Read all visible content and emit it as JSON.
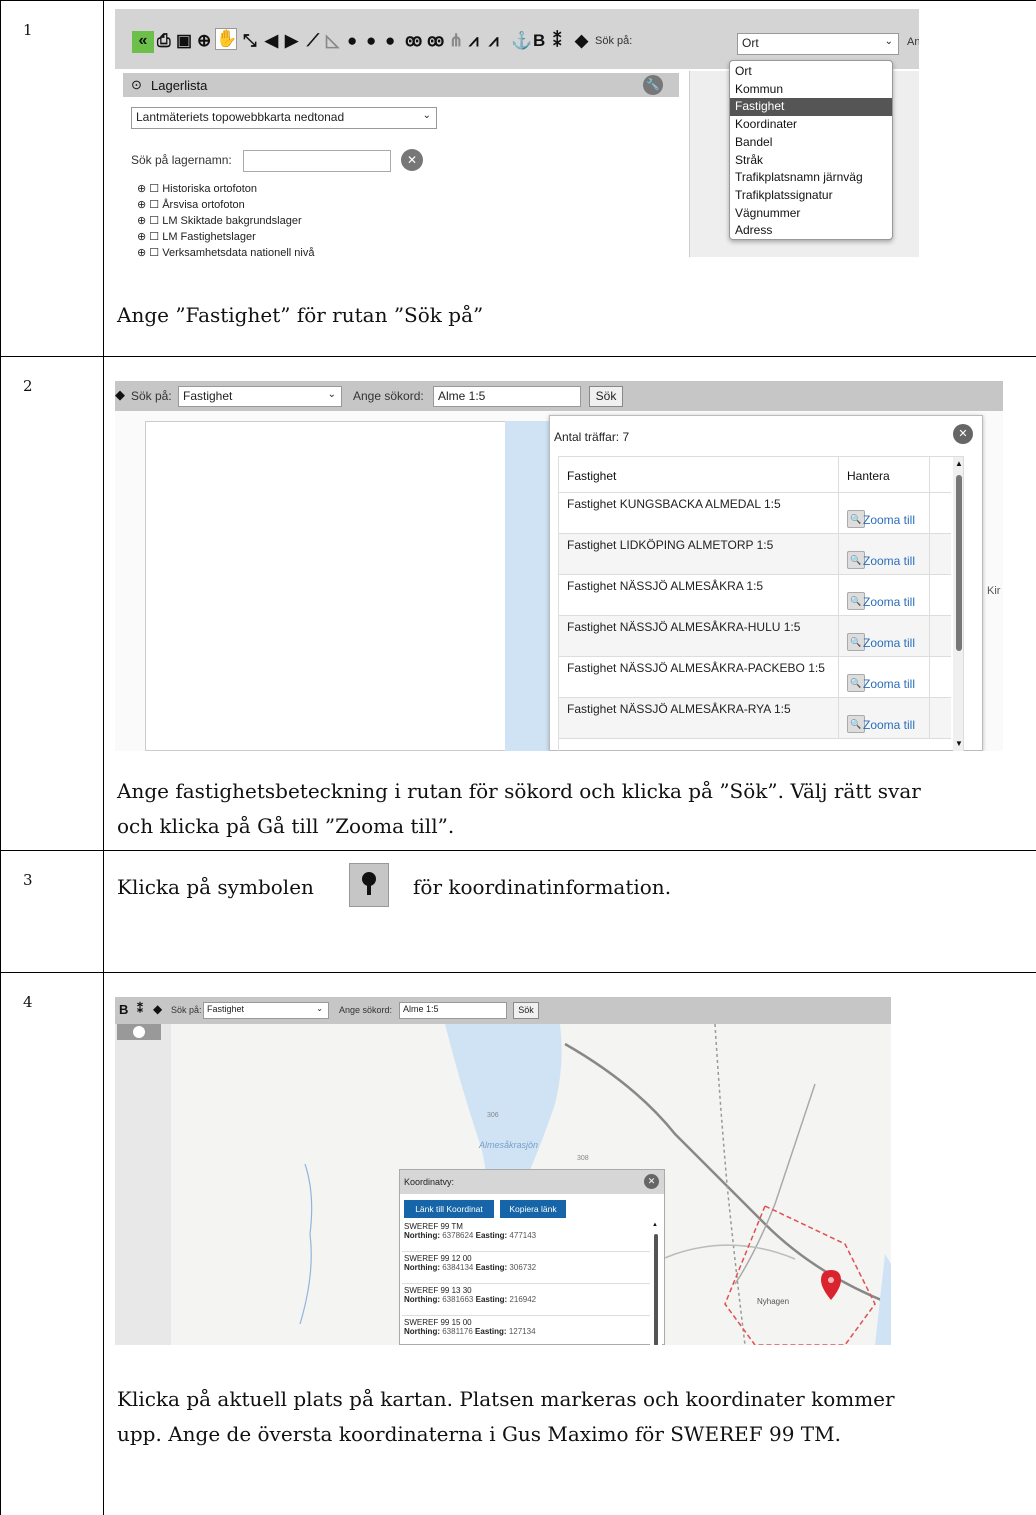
{
  "rows": [
    {
      "num": "1",
      "caption": "Ange ”Fastighet” för rutan ”Sök på”"
    },
    {
      "num": "2",
      "caption_line1": "Ange fastighetsbeteckning i rutan för sökord och klicka på ”Sök”. Välj rätt svar",
      "caption_line2": "och klicka på Gå till ”Zooma till”."
    },
    {
      "num": "3",
      "caption_pre": "Klicka på symbolen",
      "caption_post": "för koordinatinformation."
    },
    {
      "num": "4",
      "caption_line1": "Klicka på aktuell plats på kartan. Platsen markeras och koordinater kommer",
      "caption_line2": "upp. Ange de översta koordinaterna i Gus Maximo för SWEREF 99 TM."
    }
  ],
  "shot1": {
    "search_on_label": "Sök på:",
    "search_on_value": "Ort",
    "truncated_label": "An",
    "bold_b": "B",
    "layer_panel_title": "Lagerlista",
    "basemap_value": "Lantmäteriets topowebbkarta nedtonad",
    "layer_search_label": "Sök på lagernamn:",
    "layers": [
      "Historiska ortofoton",
      "Årsvisa ortofoton",
      "LM Skiktade bakgrundslager",
      "LM Fastighetslager",
      "Verksamhetsdata nationell nivå"
    ],
    "options": [
      "Ort",
      "Kommun",
      "Fastighet",
      "Koordinater",
      "Bandel",
      "Stråk",
      "Trafikplatsnamn järnväg",
      "Trafikplatssignatur",
      "Vägnummer",
      "Adress"
    ],
    "selected_option": "Fastighet"
  },
  "shot2": {
    "search_on_label": "Sök på:",
    "search_on_value": "Fastighet",
    "keyword_label": "Ange sökord:",
    "keyword_value": "Alme 1:5",
    "search_button": "Sök",
    "hits_label": "Antal träffar: 7",
    "col_property": "Fastighet",
    "col_manage": "Hantera",
    "results": [
      {
        "name": "Fastighet KUNGSBACKA ALMEDAL 1:5",
        "action": "Zooma till"
      },
      {
        "name": "Fastighet LIDKÖPING ALMETORP 1:5",
        "action": "Zooma till"
      },
      {
        "name": "Fastighet NÄSSJÖ ALMESÅKRA 1:5",
        "action": "Zooma till"
      },
      {
        "name": "Fastighet NÄSSJÖ ALMESÅKRA-HULU 1:5",
        "action": "Zooma till"
      },
      {
        "name": "Fastighet NÄSSJÖ ALMESÅKRA-PACKEBO 1:5",
        "action": "Zooma till"
      },
      {
        "name": "Fastighet NÄSSJÖ ALMESÅKRA-RYA 1:5",
        "action": "Zooma till"
      }
    ],
    "map_edge_text": "Kir"
  },
  "shot4": {
    "bold_b": "B",
    "search_on_label": "Sök på:",
    "search_on_value": "Fastighet",
    "keyword_label": "Ange sökord:",
    "keyword_value": "Alme 1:5",
    "search_button": "Sök",
    "lake_name": "Almesåkrasjön",
    "elev1": "306",
    "elev2": "308",
    "place_name": "Nyhagen",
    "coord_title": "Koordinatvy:",
    "link_button": "Länk till Koordinat",
    "copy_button": "Kopiera länk",
    "northing_label": "Northing:",
    "easting_label": "Easting:",
    "coords": [
      {
        "system": "SWEREF 99 TM",
        "northing": "6378624",
        "easting": "477143"
      },
      {
        "system": "SWEREF 99 12 00",
        "northing": "6384134",
        "easting": "306732"
      },
      {
        "system": "SWEREF 99 13 30",
        "northing": "6381663",
        "easting": "216942"
      },
      {
        "system": "SWEREF 99 15 00",
        "northing": "6381176",
        "easting": "127134"
      }
    ]
  },
  "colors": {
    "toolbar_gray": "#c6c6c6",
    "green_button": "#6cc04a",
    "dropdown_highlight": "#555555",
    "link_blue": "#2a6ebb",
    "coord_button_blue": "#1565a8",
    "marker_red": "#d9232e",
    "lake_blue": "#cfe3f5"
  }
}
